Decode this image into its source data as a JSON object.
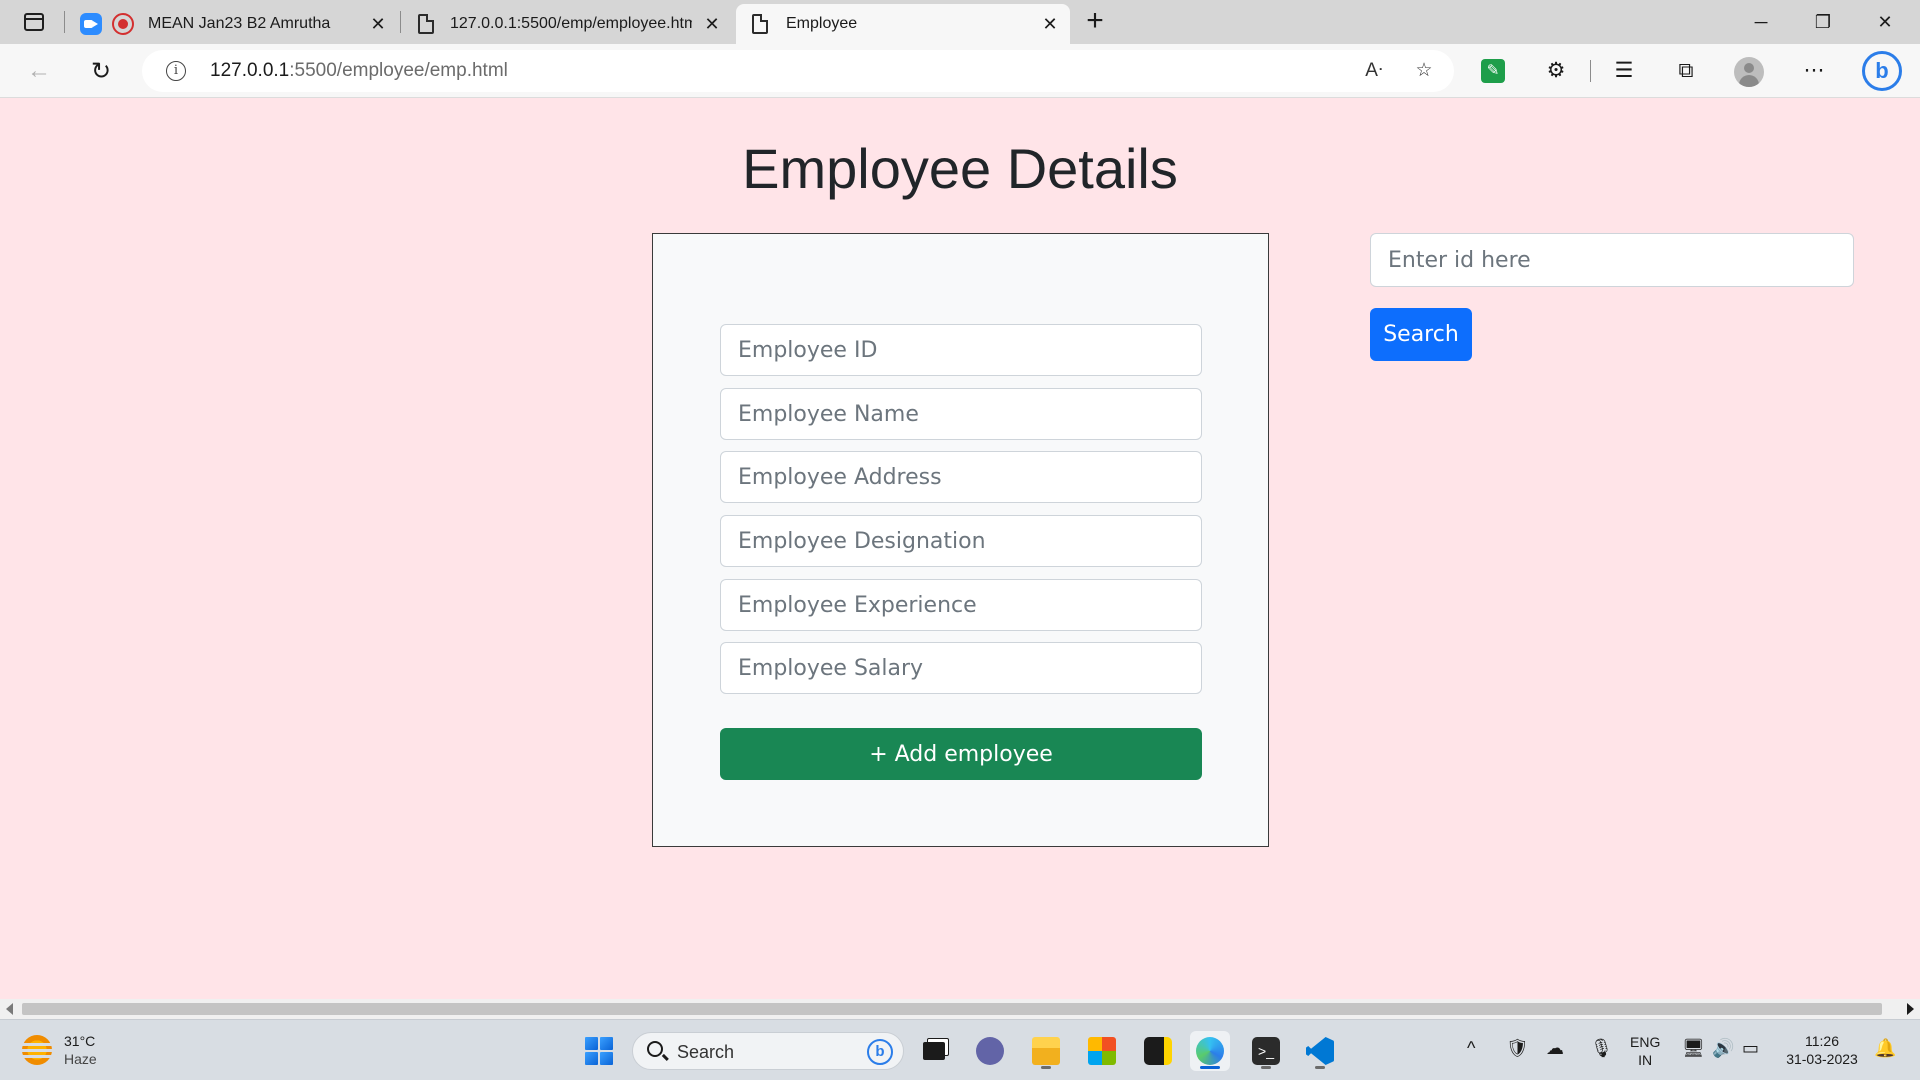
{
  "browser": {
    "tabs": [
      {
        "title": "MEAN Jan23 B2 Amrutha",
        "active": false
      },
      {
        "title": "127.0.0.1:5500/emp/employee.html",
        "active": false
      },
      {
        "title": "Employee",
        "active": true
      }
    ],
    "address": {
      "host": "127.0.0.1",
      "path": ":5500/employee/emp.html"
    }
  },
  "page": {
    "title": "Employee Details",
    "form": {
      "fields": [
        {
          "placeholder": "Employee ID",
          "value": ""
        },
        {
          "placeholder": "Employee Name",
          "value": ""
        },
        {
          "placeholder": "Employee Address",
          "value": ""
        },
        {
          "placeholder": "Employee Designation",
          "value": ""
        },
        {
          "placeholder": "Employee Experience",
          "value": ""
        },
        {
          "placeholder": "Employee Salary",
          "value": ""
        }
      ],
      "submit_label": "+ Add employee"
    },
    "search": {
      "placeholder": "Enter id here",
      "button_label": "Search"
    }
  },
  "taskbar": {
    "weather": {
      "temp": "31°C",
      "condition": "Haze"
    },
    "search_label": "Search",
    "language": {
      "line1": "ENG",
      "line2": "IN"
    },
    "clock": {
      "time": "11:26",
      "date": "31-03-2023"
    }
  },
  "colors": {
    "page_background": "#ffe4e8",
    "add_button": "#198754",
    "search_button": "#0d6efd"
  }
}
